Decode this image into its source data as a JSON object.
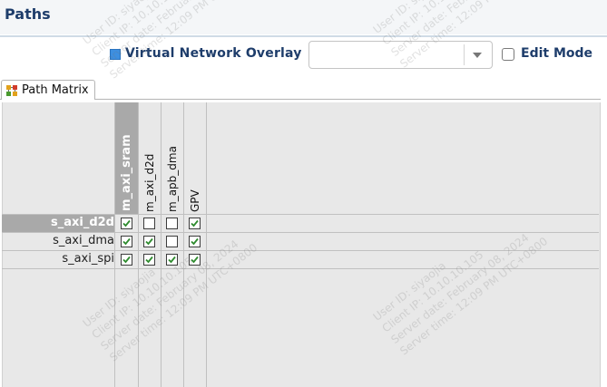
{
  "header": {
    "title": "Paths"
  },
  "toolbar": {
    "overlay_label": "Virtual Network Overlay",
    "overlay_swatch_color": "#3d8fe0",
    "overlay_select_value": "",
    "edit_mode_label": "Edit Mode",
    "edit_mode_checked": false
  },
  "tabs": [
    {
      "label": "Path Matrix",
      "icon": "path-matrix-icon",
      "active": true
    }
  ],
  "matrix": {
    "columns": [
      "m_axi_sram",
      "m_axi_d2d",
      "m_apb_dma",
      "GPV"
    ],
    "selected_column": 0,
    "rows": [
      {
        "label": "s_axi_d2d",
        "selected": true,
        "cells": [
          true,
          false,
          false,
          true
        ]
      },
      {
        "label": "s_axi_dma",
        "selected": false,
        "cells": [
          true,
          true,
          false,
          true
        ]
      },
      {
        "label": "s_axi_spi",
        "selected": false,
        "cells": [
          true,
          true,
          true,
          true
        ]
      }
    ]
  },
  "watermark": {
    "user": "User ID: siyaojia",
    "client": "Client IP: 10.10.10.105",
    "server_date": "Server date: February 08, 2024",
    "server_time": "Server time: 12:09 PM UTC+0800"
  }
}
